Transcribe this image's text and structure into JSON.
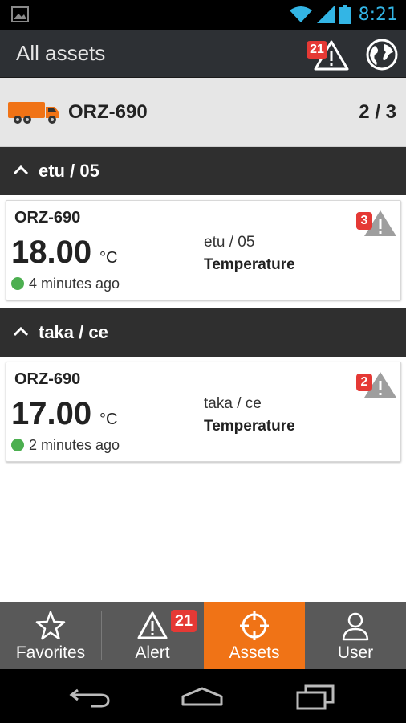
{
  "status_bar": {
    "time": "8:21",
    "icons": [
      "image-icon",
      "wifi-icon",
      "signal-icon",
      "battery-icon"
    ]
  },
  "action_bar": {
    "title": "All assets",
    "alert_badge": "21",
    "icons": [
      "alert-icon",
      "globe-icon"
    ]
  },
  "asset_header": {
    "name": "ORZ-690",
    "count": "2 / 3",
    "icon": "truck-icon",
    "truck_color": "#f07316"
  },
  "groups": [
    {
      "label": "etu / 05",
      "card": {
        "asset": "ORZ-690",
        "value": "18.00",
        "unit": "°C",
        "time_ago": "4 minutes ago",
        "sensor": "etu / 05",
        "type": "Temperature",
        "alert_count": "3"
      }
    },
    {
      "label": "taka / ce",
      "card": {
        "asset": "ORZ-690",
        "value": "17.00",
        "unit": "°C",
        "time_ago": "2 minutes ago",
        "sensor": "taka / ce",
        "type": "Temperature",
        "alert_count": "2"
      }
    }
  ],
  "tabs": [
    {
      "label": "Favorites",
      "icon": "star-icon"
    },
    {
      "label": "Alert",
      "icon": "alert-icon",
      "badge": "21"
    },
    {
      "label": "Assets",
      "icon": "crosshair-icon",
      "active": true
    },
    {
      "label": "User",
      "icon": "user-icon"
    }
  ],
  "colors": {
    "accent": "#f07316",
    "badge": "#e53935",
    "online": "#4caf50",
    "status_blue": "#33b5e5"
  },
  "nav_bar": {
    "icons": [
      "back-icon",
      "home-icon",
      "recents-icon"
    ]
  }
}
